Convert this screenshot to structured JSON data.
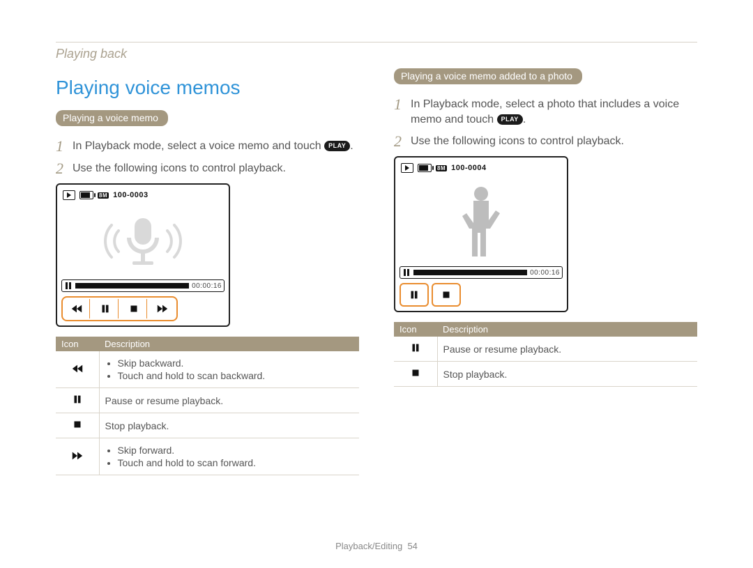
{
  "breadcrumb": "Playing back",
  "section_title": "Playing voice memos",
  "left": {
    "pill": "Playing a voice memo",
    "steps": [
      {
        "num": "1",
        "text_before": "In Playback mode, select a voice memo and touch ",
        "has_play_icon": true,
        "play_label": "PLAY",
        "text_after": "."
      },
      {
        "num": "2",
        "text_before": "Use the following icons to control playback.",
        "has_play_icon": false
      }
    ],
    "screen": {
      "file_counter": "100-0003",
      "mem_badge": "8M",
      "timestamp": "00:00:16"
    },
    "table": {
      "headers": [
        "Icon",
        "Description"
      ],
      "rows": [
        {
          "icon": "rewind",
          "type": "bullets",
          "lines": [
            "Skip backward.",
            "Touch and hold to scan backward."
          ]
        },
        {
          "icon": "pause",
          "type": "text",
          "text": "Pause or resume playback."
        },
        {
          "icon": "stop",
          "type": "text",
          "text": "Stop playback."
        },
        {
          "icon": "forward",
          "type": "bullets",
          "lines": [
            "Skip forward.",
            "Touch and hold to scan forward."
          ]
        }
      ]
    }
  },
  "right": {
    "pill": "Playing a voice memo added to a photo",
    "steps": [
      {
        "num": "1",
        "text_before": "In Playback mode, select a photo that includes a voice memo and touch ",
        "has_play_icon": true,
        "play_label": "PLAY",
        "text_after": "."
      },
      {
        "num": "2",
        "text_before": "Use the following icons to control playback.",
        "has_play_icon": false
      }
    ],
    "screen": {
      "file_counter": "100-0004",
      "mem_badge": "8M",
      "timestamp": "00:00:16"
    },
    "table": {
      "headers": [
        "Icon",
        "Description"
      ],
      "rows": [
        {
          "icon": "pause",
          "type": "text",
          "text": "Pause or resume playback."
        },
        {
          "icon": "stop",
          "type": "text",
          "text": "Stop playback."
        }
      ]
    }
  },
  "footer": {
    "section": "Playback/Editing",
    "page": "54"
  }
}
